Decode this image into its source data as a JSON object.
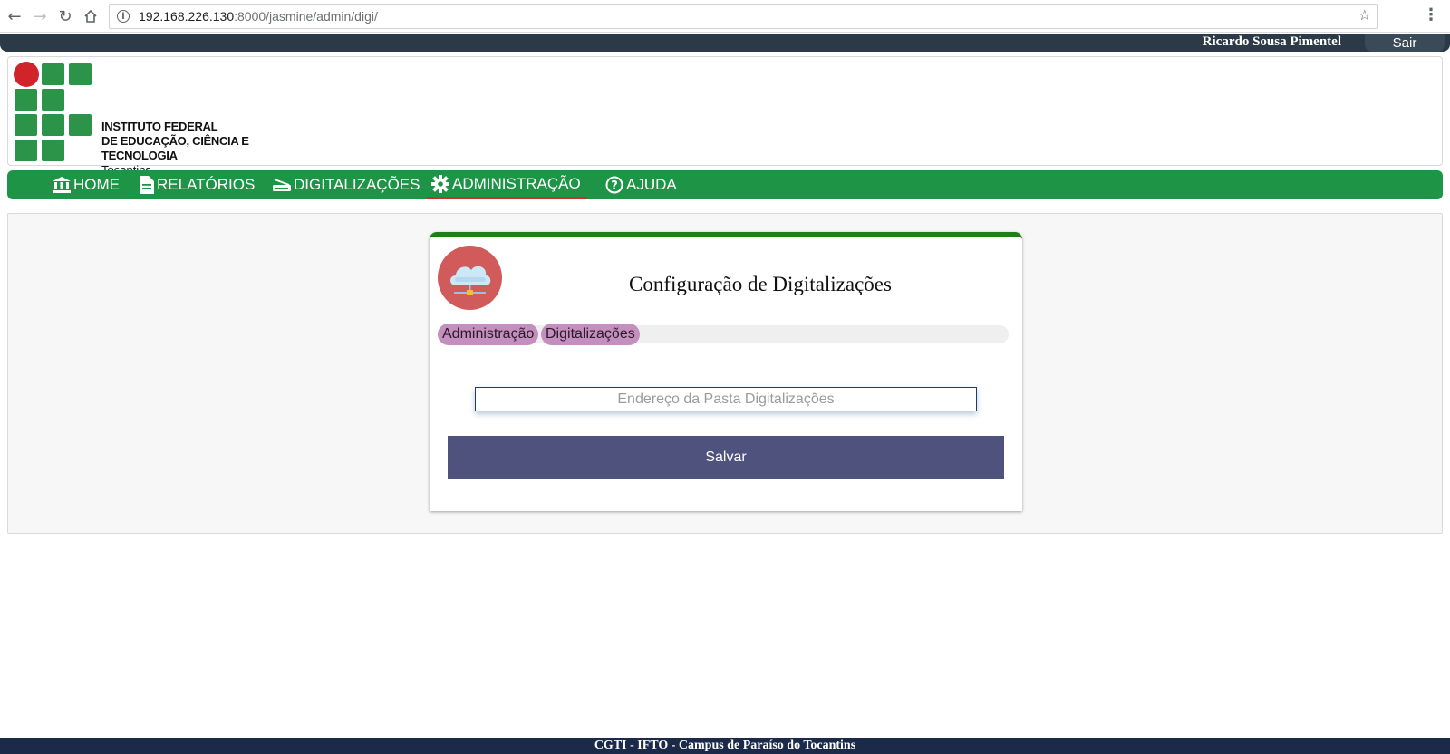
{
  "browser": {
    "url_host": "192.168.226.130",
    "url_path": ":8000/jasmine/admin/digi/"
  },
  "user_bar": {
    "user_name": "Ricardo Sousa Pimentel",
    "logout_label": "Sair"
  },
  "logo": {
    "line1": "INSTITUTO FEDERAL",
    "line2": "DE EDUCAÇÃO, CIÊNCIA E TECNOLOGIA",
    "line3": "Tocantins",
    "colors": {
      "green": "#2b9448",
      "red": "#d1232a"
    }
  },
  "nav": {
    "items": [
      {
        "label": "HOME",
        "icon": "bank-icon"
      },
      {
        "label": "RELATÓRIOS",
        "icon": "document-icon"
      },
      {
        "label": "DIGITALIZAÇÕES",
        "icon": "scanner-icon"
      },
      {
        "label": "ADMINISTRAÇÃO",
        "icon": "gear-icon",
        "active": true
      },
      {
        "label": "AJUDA",
        "icon": "help-circle-icon"
      }
    ],
    "color": "#1e9546",
    "active_underline": "#c8322a"
  },
  "card": {
    "title": "Configuração de Digitalizações",
    "icon": "cloud-network-icon",
    "breadcrumb": [
      "Administração",
      "Digitalizações"
    ],
    "input_placeholder": "Endereço da Pasta Digitalizações",
    "save_label": "Salvar"
  },
  "footer": {
    "text": "CGTI - IFTO - Campus de Paraíso do Tocantins"
  }
}
